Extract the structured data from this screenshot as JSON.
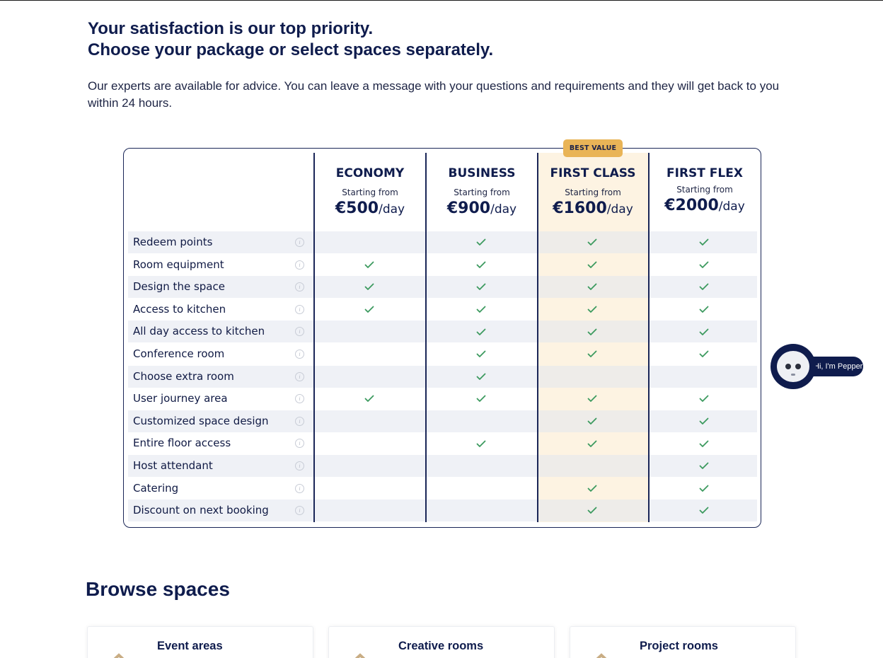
{
  "header": {
    "headline_line1": "Your satisfaction is our top priority.",
    "headline_line2": "Choose your package or select spaces separately.",
    "intro": "Our experts are available for advice. You can leave a message with your questions and requirements and they will get back to you within 24 hours."
  },
  "pricing": {
    "badge": "BEST VALUE",
    "highlight_color": "#fdf3e2",
    "check_color": "#3c9a5f",
    "plans": [
      {
        "name": "ECONOMY",
        "starting_from": "Starting from",
        "price": "€500",
        "per": "/day"
      },
      {
        "name": "BUSINESS",
        "starting_from": "Starting from",
        "price": "€900",
        "per": "/day"
      },
      {
        "name": "FIRST CLASS",
        "starting_from": "Starting from",
        "price": "€1600",
        "per": "/day"
      },
      {
        "name": "FIRST FLEX",
        "starting_from": "Starting from",
        "price": "€2000",
        "per": "/day"
      }
    ],
    "features": [
      {
        "label": "Redeem points",
        "checks": [
          false,
          true,
          true,
          true
        ]
      },
      {
        "label": "Room equipment",
        "checks": [
          true,
          true,
          true,
          true
        ]
      },
      {
        "label": "Design the space",
        "checks": [
          true,
          true,
          true,
          true
        ]
      },
      {
        "label": "Access to kitchen",
        "checks": [
          true,
          true,
          true,
          true
        ]
      },
      {
        "label": "All day access to kitchen",
        "checks": [
          false,
          true,
          true,
          true
        ]
      },
      {
        "label": "Conference room",
        "checks": [
          false,
          true,
          true,
          true
        ]
      },
      {
        "label": "Choose extra room",
        "checks": [
          false,
          true,
          false,
          false
        ]
      },
      {
        "label": "User journey area",
        "checks": [
          true,
          true,
          true,
          true
        ]
      },
      {
        "label": "Customized space design",
        "checks": [
          false,
          false,
          true,
          true
        ]
      },
      {
        "label": "Entire floor access",
        "checks": [
          false,
          true,
          true,
          true
        ]
      },
      {
        "label": "Host attendant",
        "checks": [
          false,
          false,
          false,
          true
        ]
      },
      {
        "label": "Catering",
        "checks": [
          false,
          false,
          true,
          true
        ]
      },
      {
        "label": "Discount on next booking",
        "checks": [
          false,
          false,
          true,
          true
        ]
      }
    ]
  },
  "chat_widget": {
    "label": "Hi, I'm Pepper"
  },
  "browse": {
    "title": "Browse spaces",
    "cards": [
      {
        "name": "Event areas"
      },
      {
        "name": "Creative rooms"
      },
      {
        "name": "Project rooms"
      }
    ]
  }
}
